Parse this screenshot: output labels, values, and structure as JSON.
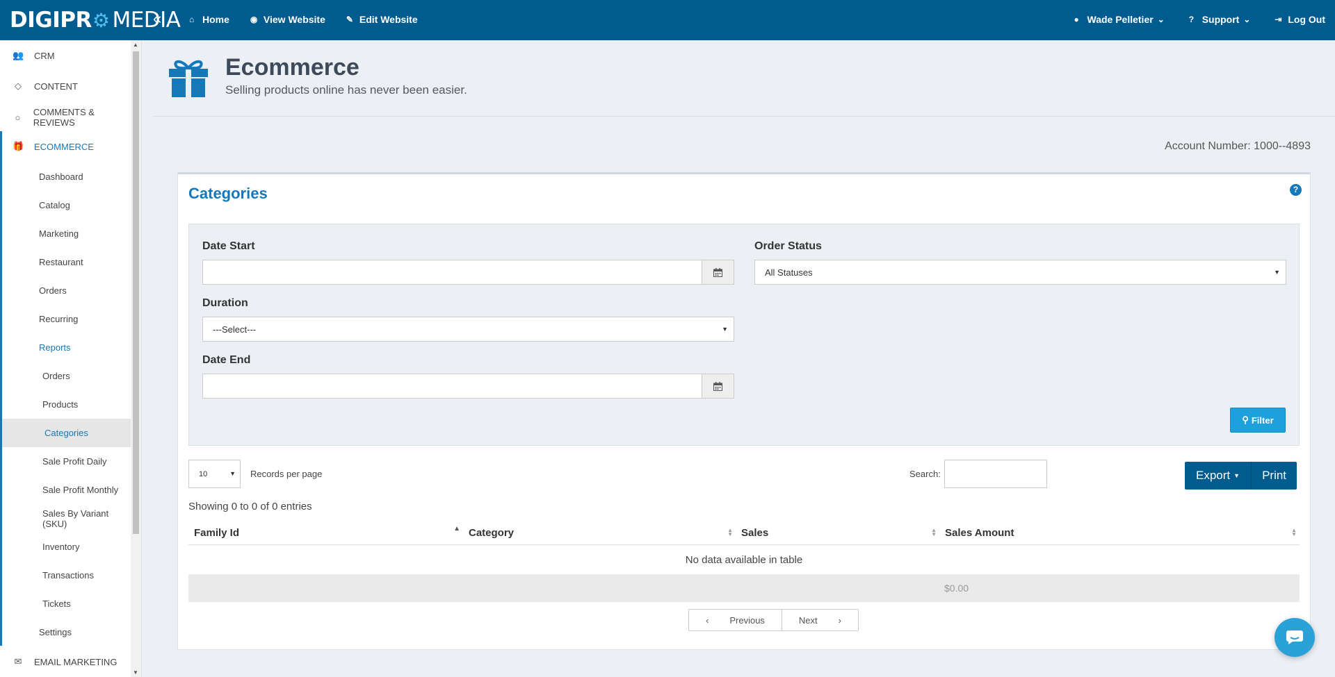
{
  "brand": {
    "logo_part1": "DIGIPR",
    "logo_gear": "⚙",
    "logo_part2": "MEDIA"
  },
  "topnav": {
    "home": "Home",
    "view_website": "View Website",
    "edit_website": "Edit Website"
  },
  "rightnav": {
    "user": "Wade Pelletier",
    "support": "Support",
    "logout": "Log Out"
  },
  "sidebar": {
    "sections": {
      "crm": "CRM",
      "content": "CONTENT",
      "comments": "COMMENTS & REVIEWS",
      "ecommerce": "ECOMMERCE",
      "email": "EMAIL MARKETING"
    },
    "ecommerce_items": [
      "Dashboard",
      "Catalog",
      "Marketing",
      "Restaurant",
      "Orders",
      "Recurring",
      "Reports"
    ],
    "report_items": [
      "Orders",
      "Products",
      "Categories",
      "Sale Profit Daily",
      "Sale Profit Monthly",
      "Sales By Variant (SKU)",
      "Inventory",
      "Transactions",
      "Tickets"
    ],
    "settings": "Settings"
  },
  "header": {
    "title": "Ecommerce",
    "subtitle": "Selling products online has never been easier."
  },
  "account": {
    "text": "Account Number: 1000--4893"
  },
  "panel": {
    "title": "Categories",
    "filters": {
      "date_start_label": "Date Start",
      "duration_label": "Duration",
      "duration_value": "---Select---",
      "date_end_label": "Date End",
      "order_status_label": "Order Status",
      "order_status_value": "All Statuses",
      "filter_button": "Filter"
    },
    "records_per_page_value": "10",
    "records_per_page_label": "Records per page",
    "search_label": "Search:",
    "export_label": "Export",
    "print_label": "Print",
    "showing": "Showing 0 to 0 of 0 entries",
    "table": {
      "columns": [
        "Family Id",
        "Category",
        "Sales",
        "Sales Amount"
      ],
      "empty": "No data available in table",
      "total_sales_amount": "$0.00"
    },
    "pager": {
      "previous": "Previous",
      "next": "Next"
    }
  },
  "colors": {
    "topbar": "#005b8f",
    "accent": "#1578b8",
    "filter_button": "#1ea0dc",
    "page_bg": "#ecf0f5"
  }
}
